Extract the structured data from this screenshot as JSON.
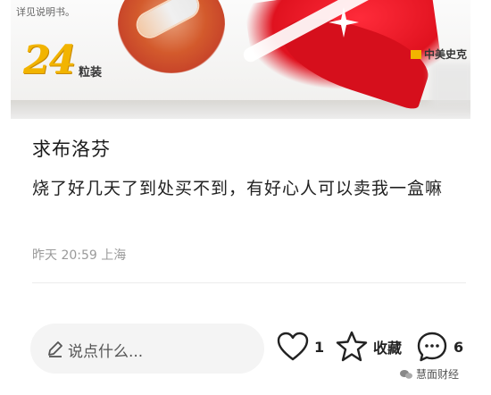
{
  "product_image": {
    "package_note": "详见说明书。",
    "count_number": "24",
    "count_unit": "粒装",
    "brand_text": "中美史克"
  },
  "post": {
    "title": "求布洛芬",
    "body": "烧了好几天了到处买不到，有好心人可以卖我一盒嘛",
    "meta": "昨天 20:59 上海"
  },
  "action_bar": {
    "comment_placeholder": "说点什么...",
    "like_count": "1",
    "favorite_label": "收藏",
    "comment_count": "6"
  },
  "watermark": {
    "text": "慧面财经"
  },
  "colors": {
    "accent_red": "#e0121f",
    "count_yellow": "#f2b400",
    "text_primary": "#1a1a1a",
    "text_secondary": "#9a9a9a",
    "input_bg": "#f4f4f4"
  }
}
